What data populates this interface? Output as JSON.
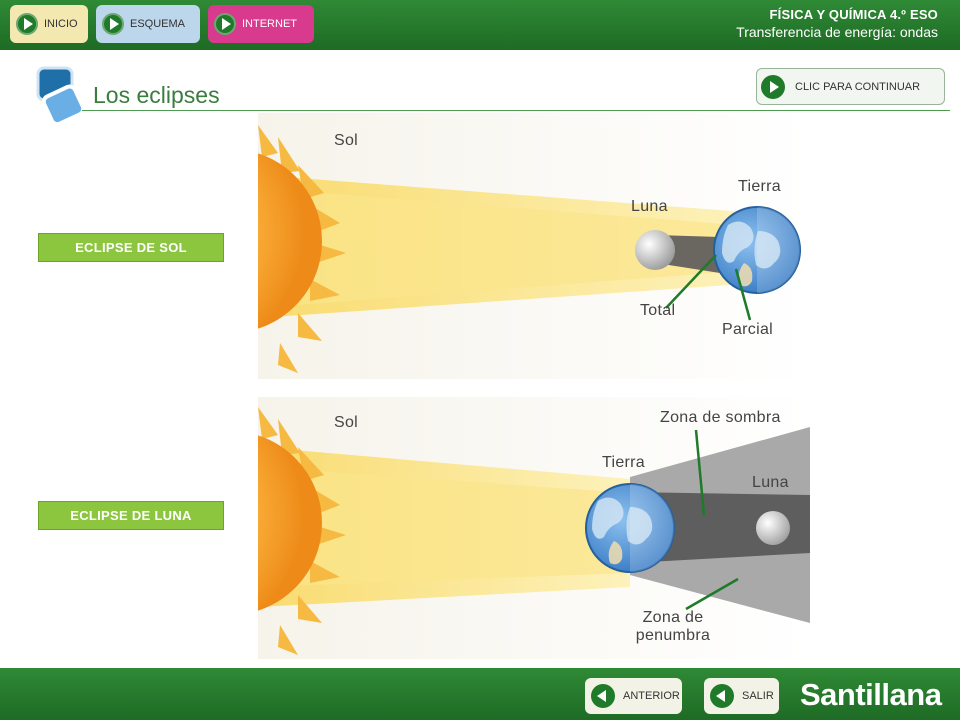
{
  "header": {
    "nav": [
      {
        "label": "INICIO"
      },
      {
        "label": "ESQUEMA"
      },
      {
        "label": "INTERNET"
      }
    ],
    "course": "FÍSICA Y QUÍMICA 4.º ESO",
    "unit": "Transferencia de energía: ondas"
  },
  "page": {
    "title": "Los eclipses",
    "continue_label": "CLIC PARA CONTINUAR"
  },
  "sections": {
    "solar": {
      "label": "ECLIPSE DE SOL",
      "sun": "Sol",
      "moon": "Luna",
      "earth": "Tierra",
      "total": "Total",
      "partial": "Parcial"
    },
    "lunar": {
      "label": "ECLIPSE DE LUNA",
      "sun": "Sol",
      "earth": "Tierra",
      "moon": "Luna",
      "umbra": "Zona de sombra",
      "penumbra_line1": "Zona de",
      "penumbra_line2": "penumbra"
    }
  },
  "footer": {
    "prev_label": "ANTERIOR",
    "exit_label": "SALIR",
    "brand": "Santillana"
  },
  "colors": {
    "bar_green": "#2e7d32",
    "label_green": "#8cc63f",
    "title_green": "#3a7d3e",
    "sun": "#f5a623",
    "earth": "#4a8fd4"
  }
}
